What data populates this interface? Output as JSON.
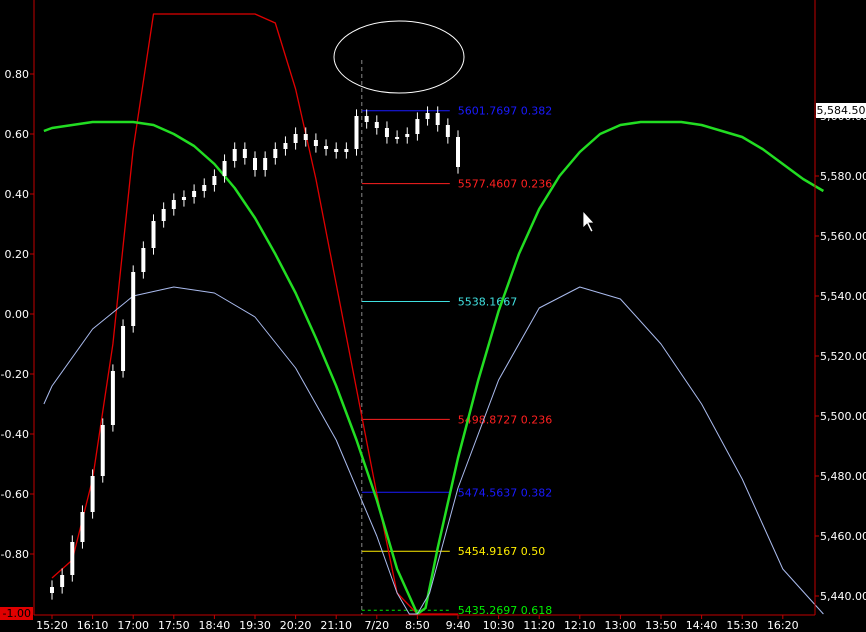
{
  "chart_data": {
    "type": "line",
    "left_axis": {
      "ticks": [
        0.8,
        0.6,
        0.4,
        0.2,
        0.0,
        -0.2,
        -0.4,
        -0.6,
        -0.8
      ],
      "tick_labels": [
        "0.80",
        "0.60",
        "0.40",
        "0.20",
        "0.00",
        "-0.20",
        "-0.40",
        "-0.60",
        "-0.80"
      ],
      "ylim": [
        -1.0,
        1.0
      ],
      "marker_label": "-1.00",
      "color": "#e00000"
    },
    "right_axis": {
      "ticks": [
        5600,
        5580,
        5560,
        5540,
        5520,
        5500,
        5480,
        5460,
        5440
      ],
      "tick_labels": [
        "5,600.00",
        "5,580.00",
        "5,560.00",
        "5,540.00",
        "5,520.00",
        "5,500.00",
        "5,480.00",
        "5,460.00",
        "5,440.00"
      ],
      "ylim": [
        5434,
        5613
      ],
      "last_price_label": "5,584.50",
      "last_price": 5584.5
    },
    "x_axis": {
      "tick_labels": [
        "15:20",
        "16:10",
        "17:00",
        "17:50",
        "18:40",
        "19:30",
        "20:20",
        "21:10",
        "7/20",
        "8:50",
        "9:40",
        "10:30",
        "11:20",
        "12:10",
        "13:00",
        "13:50",
        "14:40",
        "15:30",
        "16:20"
      ],
      "session_divider": "7/20"
    },
    "fib_levels": [
      {
        "label": "5601.7697 0.382",
        "value": 5601.7697,
        "color": "#1a1aff"
      },
      {
        "label": "5577.4607 0.236",
        "value": 5577.4607,
        "color": "#ff2020"
      },
      {
        "label": "5538.1667",
        "value": 5538.1667,
        "color": "#40e0e0"
      },
      {
        "label": "5498.8727 0.236",
        "value": 5498.8727,
        "color": "#ff2020"
      },
      {
        "label": "5474.5637 0.382",
        "value": 5474.5637,
        "color": "#1a1aff"
      },
      {
        "label": "5454.9167 0.50",
        "value": 5454.9167,
        "color": "#ffee00"
      },
      {
        "label": "5435.2697 0.618",
        "value": 5435.2697,
        "color": "#00ee00",
        "dashed": true
      }
    ],
    "series": [
      {
        "kind": "oscillator",
        "axis": "left",
        "color": "#e00000",
        "x": [
          0,
          0.5,
          1,
          1.5,
          2,
          2.5,
          3,
          3.5,
          4,
          4.5,
          5,
          5.5,
          6,
          6.5,
          7,
          7.5,
          8,
          8.5,
          9,
          9.5,
          10
        ],
        "values": [
          -0.88,
          -0.82,
          -0.55,
          -0.1,
          0.55,
          1.0,
          1.0,
          1.0,
          1.0,
          1.0,
          1.0,
          0.97,
          0.75,
          0.45,
          0.1,
          -0.25,
          -0.6,
          -0.93,
          -1.0,
          -1.0,
          -1.0
        ]
      },
      {
        "kind": "cycle",
        "axis": "left",
        "color": "#22dd22",
        "x": [
          -0.2,
          0,
          0.5,
          1,
          1.5,
          2,
          2.5,
          3,
          3.5,
          4,
          4.5,
          5,
          5.5,
          6,
          6.5,
          7,
          7.5,
          8,
          8.5,
          9,
          9.2,
          9.5,
          10,
          10.5,
          11,
          11.5,
          12,
          12.5,
          13,
          13.5,
          14,
          14.5,
          15,
          15.5,
          16,
          16.5,
          17,
          17.5,
          18,
          18.5,
          19
        ],
        "values": [
          0.61,
          0.62,
          0.63,
          0.64,
          0.64,
          0.64,
          0.63,
          0.6,
          0.56,
          0.5,
          0.42,
          0.32,
          0.2,
          0.07,
          -0.08,
          -0.24,
          -0.42,
          -0.62,
          -0.85,
          -1.0,
          -0.98,
          -0.78,
          -0.48,
          -0.22,
          0.01,
          0.2,
          0.35,
          0.46,
          0.54,
          0.6,
          0.63,
          0.64,
          0.64,
          0.64,
          0.63,
          0.61,
          0.59,
          0.55,
          0.5,
          0.45,
          0.41
        ]
      },
      {
        "kind": "cycle",
        "axis": "left",
        "color": "#aabbee",
        "x": [
          -0.2,
          0,
          1,
          2,
          3,
          4,
          5,
          6,
          7,
          8,
          8.5,
          8.8,
          9,
          9.3,
          9.6,
          10,
          11,
          12,
          13,
          14,
          15,
          16,
          17,
          18,
          19
        ],
        "values": [
          -0.3,
          -0.24,
          -0.05,
          0.06,
          0.09,
          0.07,
          -0.01,
          -0.18,
          -0.42,
          -0.74,
          -0.93,
          -1.0,
          -1.0,
          -0.93,
          -0.78,
          -0.58,
          -0.22,
          0.02,
          0.09,
          0.05,
          -0.1,
          -0.3,
          -0.55,
          -0.85,
          -1.0
        ]
      },
      {
        "kind": "price_candles",
        "axis": "right",
        "color": "#ffffff",
        "x": [
          0,
          0.25,
          0.5,
          0.75,
          1,
          1.25,
          1.5,
          1.75,
          2,
          2.25,
          2.5,
          2.75,
          3,
          3.25,
          3.5,
          3.75,
          4,
          4.25,
          4.5,
          4.75,
          5,
          5.25,
          5.5,
          5.75,
          6,
          6.25,
          6.5,
          6.75,
          7,
          7.25,
          7.5,
          7.75,
          8,
          8.25,
          8.5,
          8.75,
          9,
          9.25,
          9.5,
          9.75,
          10
        ],
        "values": [
          5443,
          5447,
          5458,
          5468,
          5480,
          5497,
          5515,
          5530,
          5548,
          5556,
          5565,
          5569,
          5572,
          5573,
          5575,
          5577,
          5580,
          5585,
          5589,
          5586,
          5582,
          5586,
          5589,
          5591,
          5594,
          5592,
          5590,
          5589,
          5588,
          5589,
          5600,
          5598,
          5596,
          5593,
          5593,
          5594,
          5599,
          5601,
          5597,
          5593,
          5583
        ]
      }
    ],
    "annotations": [
      "ellipse around recent highs",
      "mouse cursor"
    ]
  }
}
